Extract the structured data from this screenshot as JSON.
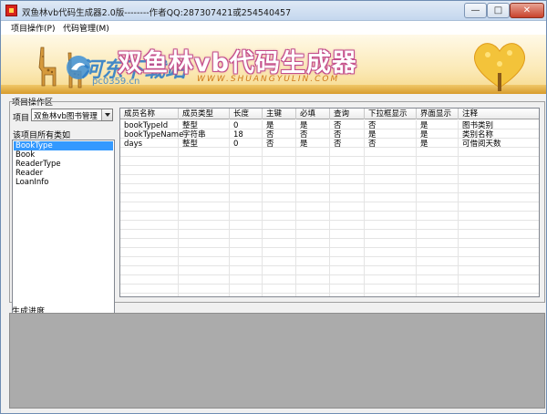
{
  "window": {
    "title": "双鱼林vb代码生成器2.0版--------作者QQ:287307421或254540457",
    "controls": {
      "minimize": "—",
      "maximize": "□",
      "close": "✕"
    }
  },
  "menu": {
    "items": [
      "项目操作(P)",
      "代码管理(M)"
    ]
  },
  "banner": {
    "title": "双鱼林vb代码生成器",
    "url": "WWW.SHUANGYULIN.COM",
    "watermark": "河东下载站",
    "watermark_url": "pc0359.cn"
  },
  "project_panel": {
    "group_label": "项目操作区",
    "project_label": "项目",
    "project_value": "双鱼林vb图书管理",
    "classes_label": "该项目所有类如",
    "classes": [
      "BookType",
      "Book",
      "ReaderType",
      "Reader",
      "LoanInfo"
    ],
    "selected_class": "BookType"
  },
  "grid": {
    "columns": [
      "成员名称",
      "成员类型",
      "长度",
      "主键",
      "必填",
      "查询",
      "下拉框显示",
      "界面显示",
      "注释"
    ],
    "rows": [
      [
        "bookTypeId",
        "整型",
        "0",
        "是",
        "是",
        "否",
        "否",
        "是",
        "图书类别"
      ],
      [
        "bookTypeName",
        "字符串",
        "18",
        "否",
        "否",
        "否",
        "是",
        "是",
        "类别名称"
      ],
      [
        "days",
        "整型",
        "0",
        "否",
        "是",
        "否",
        "否",
        "是",
        "可借阅天数"
      ]
    ]
  },
  "progress": {
    "label": "生成进度"
  },
  "colors": {
    "selection": "#3399ff",
    "titlebar": "#c4d7ee",
    "banner_title_outline": "#c44e8c",
    "watermark": "#2f7fc8"
  }
}
